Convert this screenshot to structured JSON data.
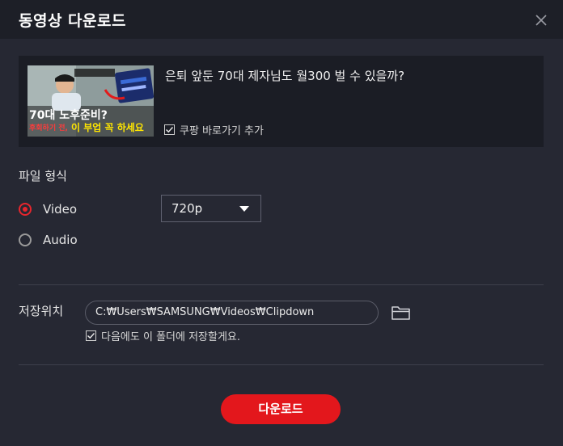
{
  "dialog": {
    "title": "동영상 다운로드",
    "close_icon": "close-icon"
  },
  "video": {
    "title": "은퇴 앞둔 70대 제자님도 월300 벌 수 있을까?",
    "thumbnail": {
      "line1": "70대 노후준비?",
      "line2": "후회하기 전,",
      "line3": "이 부업 꼭 하세요"
    },
    "coupang_checkbox": {
      "label": "쿠팡 바로가기 추가",
      "checked": true
    }
  },
  "format": {
    "label": "파일 형식",
    "options": [
      {
        "label": "Video",
        "selected": true
      },
      {
        "label": "Audio",
        "selected": false
      }
    ],
    "quality": "720p"
  },
  "save": {
    "label": "저장위치",
    "path": "C:₩Users₩SAMSUNG₩Videos₩Clipdown",
    "remember_checkbox": {
      "label": "다음에도 이 폴더에 저장할게요.",
      "checked": true
    },
    "folder_icon": "folder-icon"
  },
  "actions": {
    "download_label": "다운로드"
  },
  "colors": {
    "accent": "#e3171c",
    "background": "#262833",
    "titlebar": "#1d1f27",
    "card": "#1b1d25"
  }
}
